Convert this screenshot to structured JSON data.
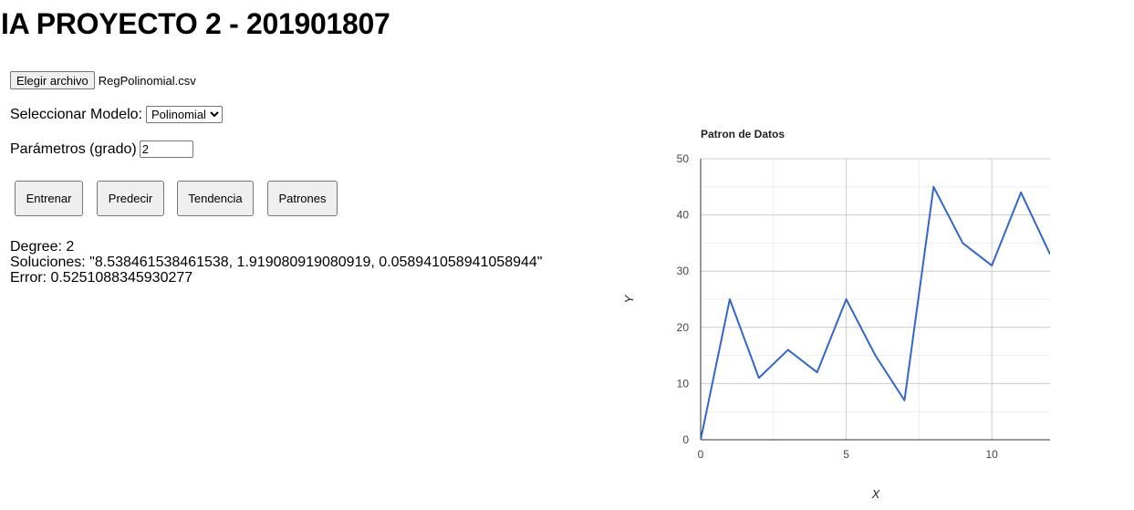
{
  "title": "IA PROYECTO 2 - 201901807",
  "file": {
    "button_label": "Elegir archivo",
    "file_name": "RegPolinomial.csv"
  },
  "model": {
    "label": "Seleccionar Modelo:",
    "selected": "Polinomial"
  },
  "params": {
    "label": "Parámetros (grado)",
    "value": "2"
  },
  "buttons": {
    "train": "Entrenar",
    "predict": "Predecir",
    "trend": "Tendencia",
    "patterns": "Patrones"
  },
  "results": {
    "degree": "Degree: 2",
    "solutions": "Soluciones: \"8.538461538461538, 1.919080919080919, 0.058941058941058944\"",
    "error": "Error: 0.5251088345930277"
  },
  "chart_data": {
    "type": "line",
    "title": "Patron de Datos",
    "xlabel": "X",
    "ylabel": "Y",
    "x": [
      0,
      1,
      2,
      3,
      4,
      5,
      6,
      7,
      8,
      9,
      10,
      11,
      12
    ],
    "series": [
      {
        "values": [
          0,
          25,
          11,
          16,
          12,
          25,
          15,
          7,
          45,
          35,
          31,
          44,
          33
        ]
      }
    ],
    "xlim": [
      0,
      12
    ],
    "ylim": [
      0,
      50
    ],
    "x_ticks": [
      0,
      5,
      10
    ],
    "y_ticks": [
      0,
      10,
      20,
      30,
      40,
      50
    ],
    "grid": true,
    "line_color": "#3366cc"
  }
}
